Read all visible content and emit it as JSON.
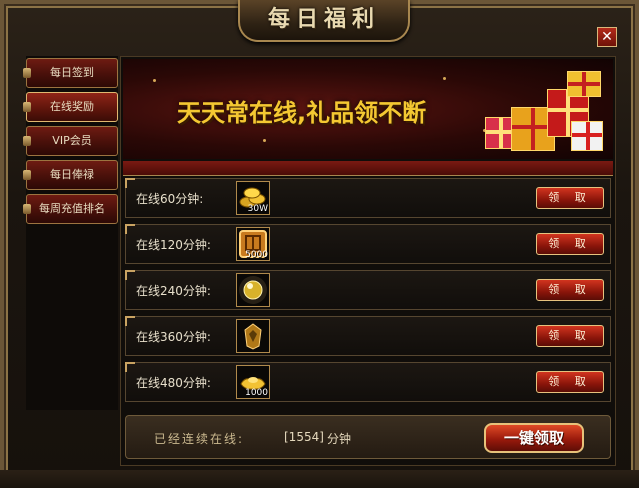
{
  "window": {
    "title": "每日福利",
    "close_label": "✕"
  },
  "sidebar": {
    "items": [
      {
        "label": "每日签到",
        "active": false
      },
      {
        "label": "在线奖励",
        "active": true
      },
      {
        "label": "VIP会员",
        "active": false
      },
      {
        "label": "每日俸禄",
        "active": false
      },
      {
        "label": "每周充值排名",
        "active": false
      }
    ]
  },
  "banner": {
    "text": "天天常在线,礼品领不断"
  },
  "rewards": [
    {
      "label": "在线60分钟:",
      "item_icon": "gold-coins-icon",
      "qty": "30W",
      "button": "领 取"
    },
    {
      "label": "在线120分钟:",
      "item_icon": "token-icon",
      "qty": "5000",
      "button": "领 取"
    },
    {
      "label": "在线240分钟:",
      "item_icon": "glowing-orb-icon",
      "qty": "",
      "button": "领 取"
    },
    {
      "label": "在线360分钟:",
      "item_icon": "amulet-icon",
      "qty": "",
      "button": "领 取"
    },
    {
      "label": "在线480分钟:",
      "item_icon": "gold-ingot-icon",
      "qty": "1000",
      "button": "领 取"
    }
  ],
  "footer": {
    "label": "已经连续在线:",
    "value": "[1554]",
    "unit": "分钟",
    "claim_all": "一键领取"
  },
  "colors": {
    "accent_red": "#8a150a",
    "gold": "#e6c27e",
    "banner_text": "#f4c832"
  }
}
